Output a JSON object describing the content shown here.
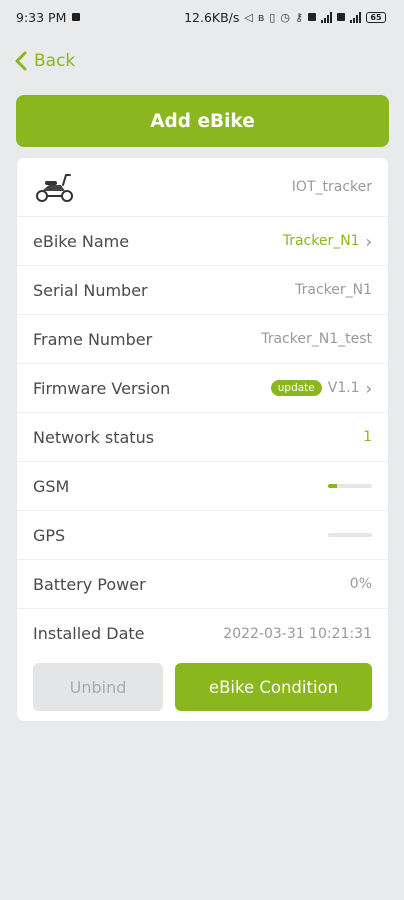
{
  "status_bar": {
    "time": "9:33 PM",
    "network_speed": "12.6KB/s",
    "battery": "65"
  },
  "nav": {
    "back_label": "Back"
  },
  "add_button_label": "Add eBike",
  "device": {
    "id": "IOT_tracker",
    "icon": "scooter-icon"
  },
  "details": {
    "ebike_name": {
      "label": "eBike Name",
      "value": "Tracker_N1"
    },
    "serial_number": {
      "label": "Serial Number",
      "value": "Tracker_N1"
    },
    "frame_number": {
      "label": "Frame Number",
      "value": "Tracker_N1_test"
    },
    "firmware": {
      "label": "Firmware Version",
      "badge": "update",
      "value": "V1.1"
    },
    "network_status": {
      "label": "Network status",
      "value": "1"
    },
    "gsm": {
      "label": "GSM",
      "level": 0.2
    },
    "gps": {
      "label": "GPS",
      "level": 0
    },
    "battery_power": {
      "label": "Battery Power",
      "value": "0%"
    },
    "installed_date": {
      "label": "Installed Date",
      "value": "2022-03-31 10:21:31"
    }
  },
  "actions": {
    "unbind_label": "Unbind",
    "condition_label": "eBike Condition"
  },
  "colors": {
    "accent": "#8bb71e",
    "background": "#e8eaeb"
  }
}
